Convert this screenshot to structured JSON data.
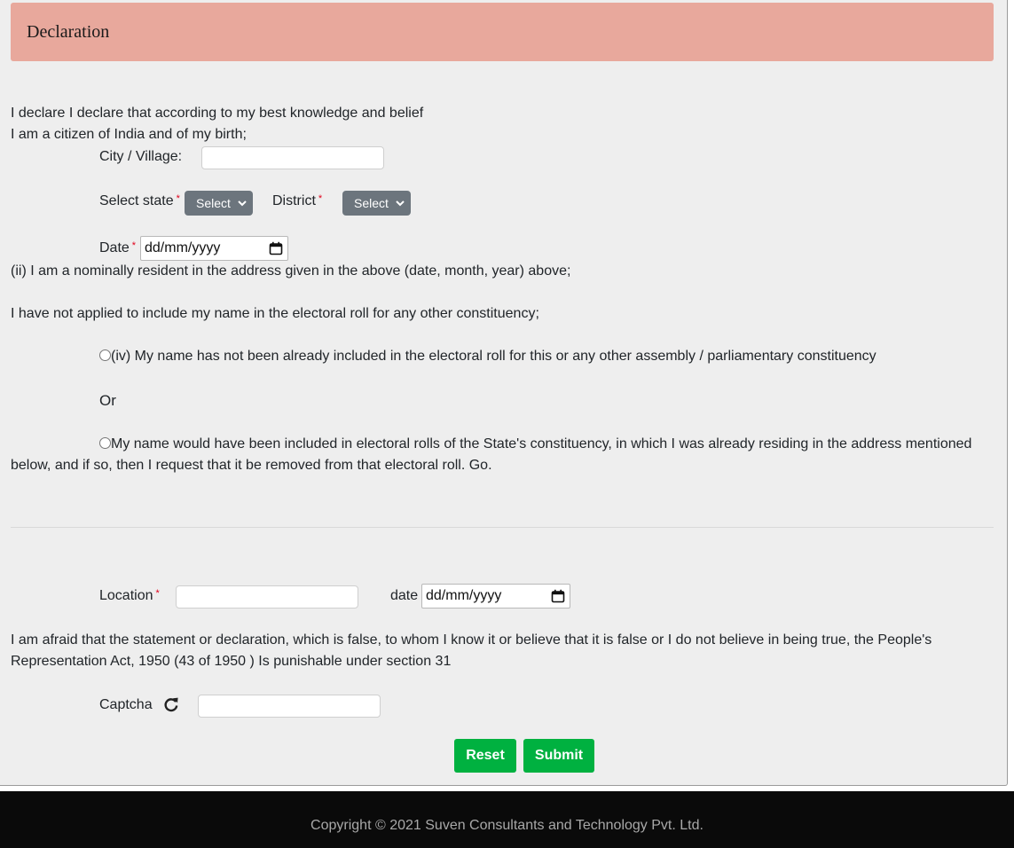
{
  "header": {
    "title": "Declaration"
  },
  "declaration": {
    "line1": "I declare I declare that according to my best knowledge and belief",
    "line2": "I am a citizen of India and of my birth;",
    "city_label": "City / Village:",
    "state_label": "Select state",
    "state_select": "Select",
    "district_label": "District",
    "district_select": "Select",
    "date_label": "Date",
    "date_placeholder": "dd/mm/yyyy",
    "resident_text": "(ii) I am a nominally resident in the address given in the above (date, month, year) above;",
    "not_applied_text": "I have not applied to include my name in the electoral roll for any other constituency;",
    "option1_text": "(iv) My name has not been already included in the electoral roll for this or any other assembly / parliamentary constituency",
    "or_text": "Or",
    "option2_text": "My name would have been included in electoral rolls of the State's constituency, in which I was already residing in the address mentioned below, and if so, then I request that it be removed from that electoral roll. Go."
  },
  "signature": {
    "location_label": "Location",
    "date_label": "date",
    "date_placeholder": "dd/mm/yyyy",
    "warning_text": "I am afraid that the statement or declaration, which is false, to whom I know it or believe that it is false or I do not believe in being true, the People's Representation Act, 1950 (43 of 1950 ) Is punishable under section 31",
    "captcha_label": "Captcha"
  },
  "buttons": {
    "reset": "Reset",
    "submit": "Submit"
  },
  "footer": {
    "copyright": "Copyright © 2021 Suven Consultants and Technology Pvt. Ltd."
  },
  "colors": {
    "header_bg": "#e8a89c",
    "select_bg": "#6c757d",
    "button_bg": "#00b140",
    "footer_bg": "#0a0a0a",
    "required": "#e0001a"
  },
  "icons": {
    "refresh": "refresh-icon",
    "calendar": "calendar-icon",
    "chevron": "chevron-down-icon"
  }
}
